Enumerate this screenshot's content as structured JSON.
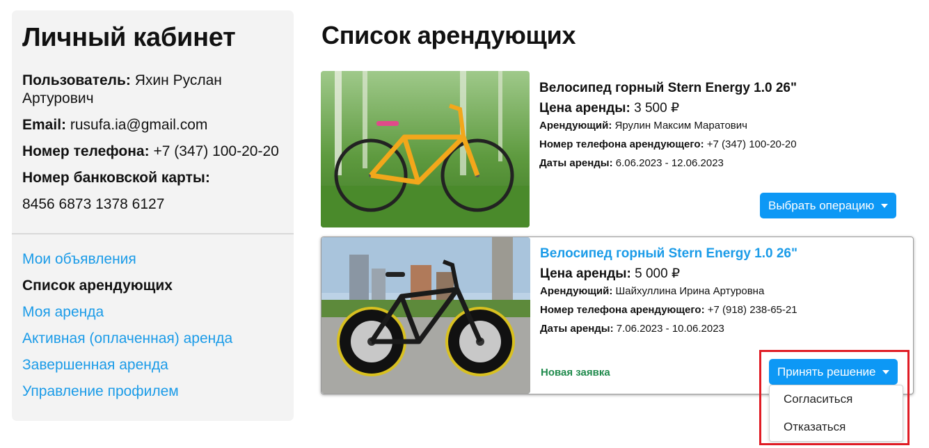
{
  "sidebar": {
    "title": "Личный кабинет",
    "user_label": "Пользователь:",
    "user_value": "Яхин Руслан Артурович",
    "email_label": "Email:",
    "email_value": "rusufa.ia@gmail.com",
    "phone_label": "Номер телефона:",
    "phone_value": "+7 (347) 100-20-20",
    "card_label": "Номер банковской карты:",
    "card_value": "8456 6873 1378 6127",
    "nav": [
      {
        "label": "Мои объявления"
      },
      {
        "label": "Список арендующих",
        "active": true
      },
      {
        "label": "Моя аренда"
      },
      {
        "label": "Активная (оплаченная) аренда"
      },
      {
        "label": "Завершенная аренда"
      },
      {
        "label": "Управление профилем"
      }
    ]
  },
  "main": {
    "title": "Список арендующих",
    "cards": [
      {
        "title": "Велосипед горный Stern Energy 1.0 26\"",
        "price_label": "Цена аренды:",
        "price_value": "3 500 ₽",
        "renter_label": "Арендующий:",
        "renter_value": "Ярулин Максим Маратович",
        "phone_label": "Номер телефона арендующего:",
        "phone_value": "+7 (347) 100-20-20",
        "dates_label": "Даты аренды:",
        "dates_value": "6.06.2023 - 12.06.2023",
        "button_label": "Выбрать операцию"
      },
      {
        "title": "Велосипед горный Stern Energy 1.0 26\"",
        "price_label": "Цена аренды:",
        "price_value": "5 000 ₽",
        "renter_label": "Арендующий:",
        "renter_value": "Шайхуллина Ирина Артуровна",
        "phone_label": "Номер телефона арендующего:",
        "phone_value": "+7 (918) 238-65-21",
        "dates_label": "Даты аренды:",
        "dates_value": "7.06.2023 - 10.06.2023",
        "status": "Новая заявка",
        "button_label": "Принять решение",
        "menu": [
          "Согласиться",
          "Отказаться"
        ]
      }
    ]
  },
  "colors": {
    "accent": "#0d98f5",
    "link": "#1a9be8",
    "status": "#1f8a4c",
    "highlight": "#e01b24",
    "sidebar_bg": "#f3f3f3"
  }
}
